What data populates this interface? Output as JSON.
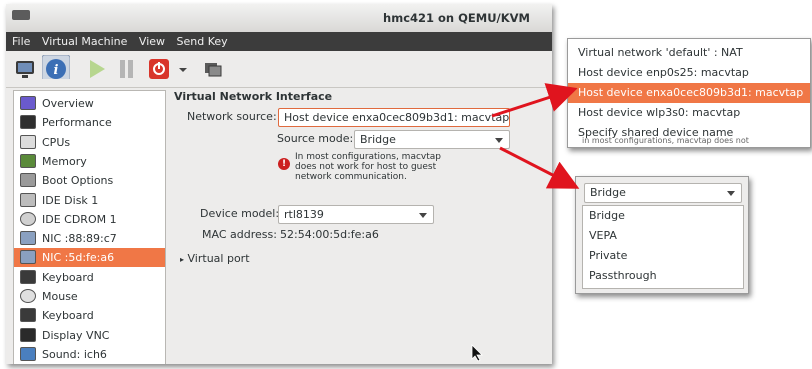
{
  "window": {
    "title": "hmc421 on QEMU/KVM"
  },
  "menu": [
    "File",
    "Virtual Machine",
    "View",
    "Send Key"
  ],
  "toolbar": {
    "icons": [
      "monitor-icon",
      "info-icon",
      "play-icon",
      "pause-icon",
      "power-icon",
      "dropdown-caret-icon",
      "screenshot-icon"
    ]
  },
  "sidebar": {
    "items": [
      {
        "label": "Overview",
        "icon": "overview-icon"
      },
      {
        "label": "Performance",
        "icon": "performance-icon"
      },
      {
        "label": "CPUs",
        "icon": "cpu-icon"
      },
      {
        "label": "Memory",
        "icon": "memory-icon"
      },
      {
        "label": "Boot Options",
        "icon": "boot-icon"
      },
      {
        "label": "IDE Disk 1",
        "icon": "disk-icon"
      },
      {
        "label": "IDE CDROM 1",
        "icon": "cdrom-icon"
      },
      {
        "label": "NIC :88:89:c7",
        "icon": "nic-icon"
      },
      {
        "label": "NIC :5d:fe:a6",
        "icon": "nic-icon",
        "selected": true
      },
      {
        "label": "Keyboard",
        "icon": "keyboard-icon"
      },
      {
        "label": "Mouse",
        "icon": "mouse-icon"
      },
      {
        "label": "Keyboard",
        "icon": "keyboard-icon"
      },
      {
        "label": "Display VNC",
        "icon": "display-icon"
      },
      {
        "label": "Sound: ich6",
        "icon": "sound-icon"
      }
    ]
  },
  "nic": {
    "section_title": "Virtual Network Interface",
    "network_source_label": "Network source:",
    "network_source_value": "Host device enxa0cec809b3d1: macvtap",
    "source_mode_label": "Source mode:",
    "source_mode_value": "Bridge",
    "warning": "In most configurations, macvtap does not work for host to guest network communication.",
    "device_model_label": "Device model:",
    "device_model_value": "rtl8139",
    "mac_label": "MAC address:",
    "mac_value": "52:54:00:5d:fe:a6",
    "virtual_port_label": "Virtual port"
  },
  "network_source_popup": {
    "options": [
      "Virtual network 'default' : NAT",
      "Host device enp0s25: macvtap",
      "Host device enxa0cec809b3d1: macvtap",
      "Host device wlp3s0: macvtap",
      "Specify shared device name"
    ],
    "highlighted": 2,
    "residual_text": "in most configurations, macvtap does not"
  },
  "source_mode_popup": {
    "selected": "Bridge",
    "options": [
      "Bridge",
      "VEPA",
      "Private",
      "Passthrough"
    ]
  },
  "colors": {
    "accent": "#f07746",
    "arrow": "#e0141e",
    "menubar": "#3c3c3c"
  }
}
